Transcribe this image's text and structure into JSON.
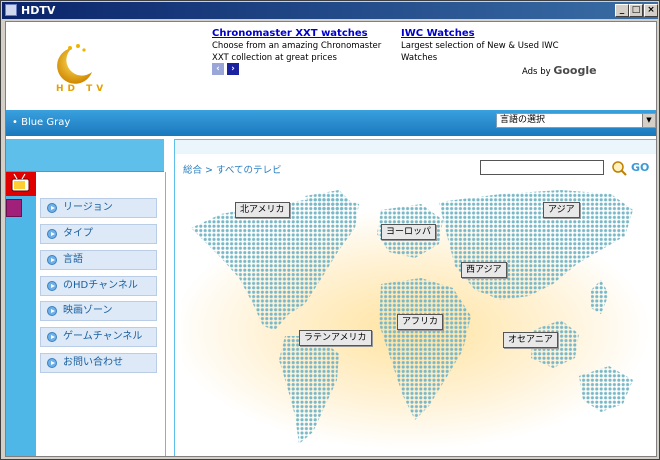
{
  "window": {
    "title": "HDTV"
  },
  "header": {
    "logo_text": "HD TV",
    "ads": [
      {
        "title": "Chronomaster XXT watches",
        "desc": "Choose from an amazing Chronomaster XXT collection at great prices"
      },
      {
        "title": "IWC Watches",
        "desc": "Largest selection of New & Used IWC Watches"
      }
    ],
    "ads_by": "Ads by",
    "google": "Google"
  },
  "themebar": {
    "themes": "• Blue  Gray",
    "language_select": "言語の選択"
  },
  "sidebar": {
    "items": [
      {
        "label": "リージョン"
      },
      {
        "label": "タイプ"
      },
      {
        "label": "言語"
      },
      {
        "label": "のHDチャンネル"
      },
      {
        "label": "映画ゾーン"
      },
      {
        "label": "ゲームチャンネル"
      },
      {
        "label": "お問い合わせ"
      }
    ]
  },
  "main": {
    "breadcrumb": "総合 > すべてのテレビ",
    "search_value": "",
    "go_label": "GO",
    "regions": [
      {
        "label": "北アメリカ"
      },
      {
        "label": "ヨーロッパ"
      },
      {
        "label": "アジア"
      },
      {
        "label": "西アジア"
      },
      {
        "label": "アフリカ"
      },
      {
        "label": "ラテンアメリカ"
      },
      {
        "label": "オセアニア"
      }
    ]
  },
  "colors": {
    "accent_blue": "#1d82c6",
    "sidebar_light_blue": "#5ec0ea",
    "logo_gold": "#e6a000",
    "map_dot": "#7ab8c8"
  }
}
